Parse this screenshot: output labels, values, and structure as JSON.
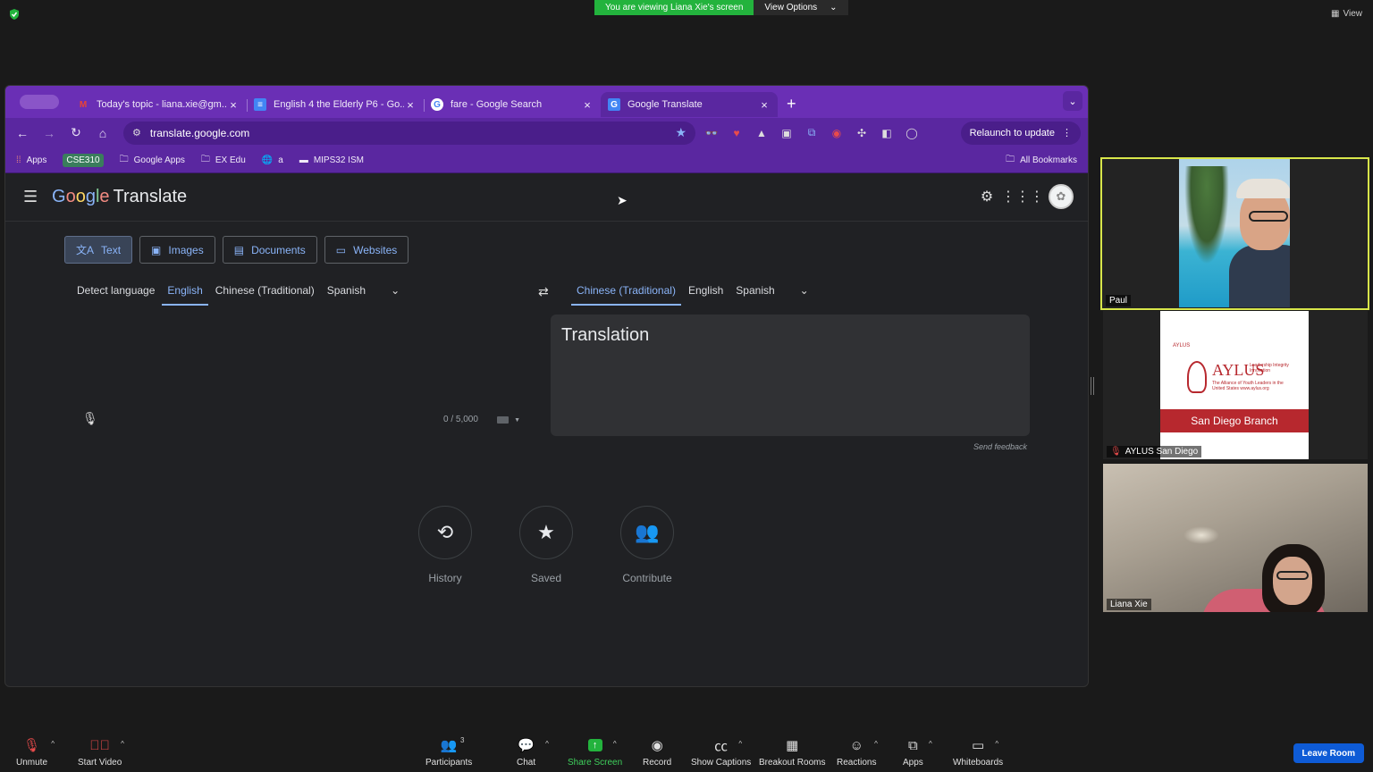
{
  "zoom": {
    "banner_text": "You are viewing Liana Xie's screen",
    "view_options": "View Options",
    "view_label": "View",
    "leave_label": "Leave Room",
    "toolbar": [
      {
        "label": "Unmute",
        "icon": "mic-muted-icon"
      },
      {
        "label": "Start Video",
        "icon": "video-off-icon"
      },
      {
        "label": "Participants",
        "icon": "participants-icon",
        "count": "3"
      },
      {
        "label": "Chat",
        "icon": "chat-icon"
      },
      {
        "label": "Share Screen",
        "icon": "share-screen-icon"
      },
      {
        "label": "Record",
        "icon": "record-icon"
      },
      {
        "label": "Show Captions",
        "icon": "captions-icon"
      },
      {
        "label": "Breakout Rooms",
        "icon": "breakout-rooms-icon"
      },
      {
        "label": "Reactions",
        "icon": "reactions-icon"
      },
      {
        "label": "Apps",
        "icon": "apps-icon"
      },
      {
        "label": "Whiteboards",
        "icon": "whiteboard-icon"
      }
    ],
    "participants": [
      {
        "name": "Paul"
      },
      {
        "name": "AYLUS San Diego"
      },
      {
        "name": "Liana Xie"
      }
    ],
    "aylus_card": {
      "small": "AYLUS",
      "title": "AYLUS",
      "tagline": "Leadership Integrity Innovation",
      "subtitle": "The Alliance of Youth Leaders in the United States www.aylus.org",
      "branch": "San Diego Branch"
    }
  },
  "browser": {
    "tabs": [
      {
        "label": "Today's topic - liana.xie@gm...",
        "icon": "gmail-icon",
        "color": "#ea4335"
      },
      {
        "label": "English 4 the Elderly P6 - Go...",
        "icon": "docs-icon",
        "color": "#4285f4"
      },
      {
        "label": "fare - Google Search",
        "icon": "google-icon",
        "color": "#ffffff"
      },
      {
        "label": "Google Translate",
        "icon": "translate-icon",
        "color": "#4285f4"
      }
    ],
    "url": "translate.google.com",
    "relaunch_label": "Relaunch to update",
    "bookmarks": [
      {
        "label": "Apps",
        "icon": "apps-grid-icon"
      },
      {
        "label": "CSE310",
        "icon": "badge"
      },
      {
        "label": "Google Apps",
        "icon": "folder-icon"
      },
      {
        "label": "EX Edu",
        "icon": "folder-icon"
      },
      {
        "label": "a",
        "icon": "globe-icon"
      },
      {
        "label": "MIPS32 ISM",
        "icon": "page-icon"
      }
    ],
    "all_bookmarks": "All Bookmarks"
  },
  "translate": {
    "product": "Translate",
    "modes": [
      "Text",
      "Images",
      "Documents",
      "Websites"
    ],
    "source_langs": [
      "Detect language",
      "English",
      "Chinese (Traditional)",
      "Spanish"
    ],
    "target_langs": [
      "Chinese (Traditional)",
      "English",
      "Spanish"
    ],
    "char_count": "0 / 5,000",
    "translation_placeholder": "Translation",
    "send_feedback": "Send feedback",
    "actions": [
      {
        "label": "History",
        "icon": "history-icon"
      },
      {
        "label": "Saved",
        "icon": "star-icon"
      },
      {
        "label": "Contribute",
        "icon": "contribute-icon"
      }
    ]
  }
}
